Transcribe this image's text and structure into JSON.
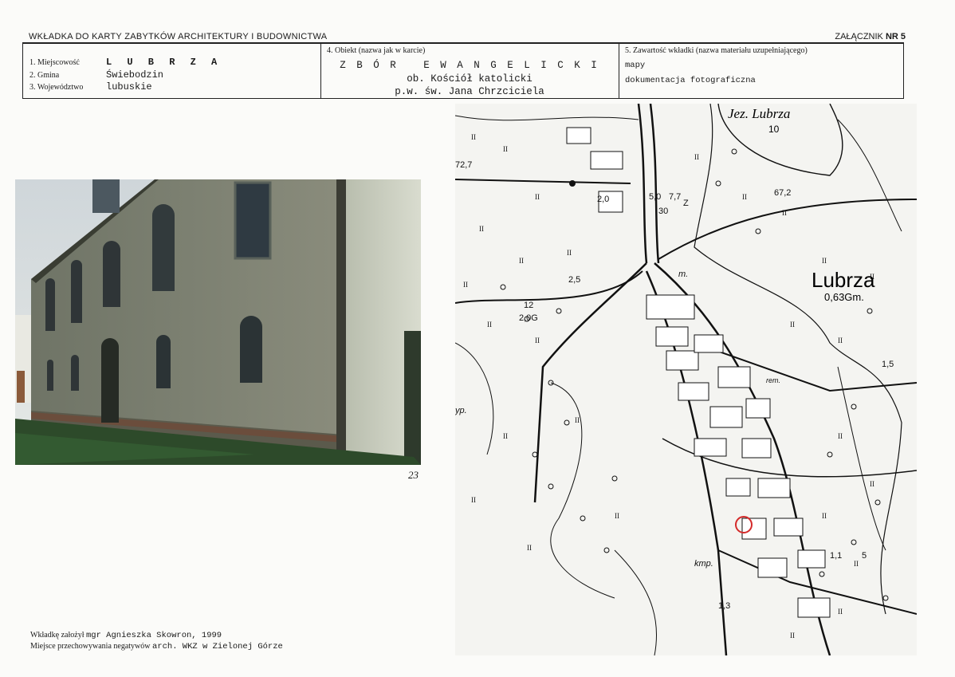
{
  "header": {
    "title": "WKŁADKA DO KARTY ZABYTKÓW ARCHITEKTURY I BUDOWNICTWA",
    "annex_label": "ZAŁĄCZNIK",
    "annex_number": "NR 5"
  },
  "location": {
    "town_label": "1. Miejscowość",
    "town": "L U B R Z A",
    "commune_label": "2. Gmina",
    "commune": "Świebodzin",
    "voivodeship_label": "3. Województwo",
    "voivodeship": "lubuskie"
  },
  "object": {
    "label": "4. Obiekt (nazwa jak w karcie)",
    "name": "Z B Ó R   E W A N G E L I C K I",
    "line2": "ob. Kościół katolicki",
    "line3": "p.w. św. Jana Chrzciciela"
  },
  "contents": {
    "label": "5. Zawartość wkładki (nazwa materiału uzupełniającego)",
    "item1": "mapy",
    "item2": "dokumentacja fotograficzna"
  },
  "photo": {
    "number": "23"
  },
  "map": {
    "lake_label": "Jez. Lubrza",
    "lake_num": "10",
    "town_label": "Lubrza",
    "town_sub": "0,63Gm.",
    "labels": [
      "72,7",
      "2,0",
      "5,0",
      "7,7",
      "30",
      "67,2",
      "12",
      "2,0G",
      "2,5",
      "1,5",
      "1,1",
      "5",
      "1,3",
      "kmp.",
      "m.",
      "rem.",
      "yp.",
      "Z"
    ]
  },
  "footer": {
    "author_label": "Wkładkę założył",
    "author": "mgr Agnieszka Skowron, 1999",
    "storage_label": "Miejsce przechowywania negatywów",
    "storage": "arch. WKZ w Zielonej Górze"
  }
}
